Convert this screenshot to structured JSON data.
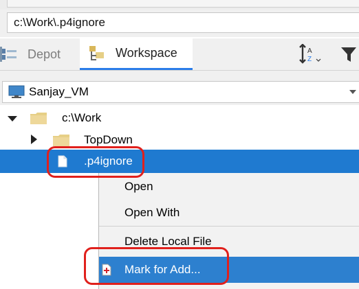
{
  "path": {
    "value": "c:\\Work\\.p4ignore"
  },
  "tabs": [
    {
      "label": "Depot",
      "icon": "depot-icon",
      "active": false
    },
    {
      "label": "Workspace",
      "icon": "workspace-icon",
      "active": true
    }
  ],
  "toolbar": {
    "sort_icon": "sort-az-icon",
    "filter_icon": "filter-icon"
  },
  "workspace_selector": {
    "value": "Sanjay_VM",
    "icon": "monitor-icon"
  },
  "tree": [
    {
      "label": "c:\\Work",
      "expanded": true,
      "type": "folder"
    },
    {
      "label": "TopDown",
      "expanded": false,
      "type": "folder"
    },
    {
      "label": ".p4ignore",
      "selected": true,
      "type": "file"
    }
  ],
  "context_menu": {
    "items": [
      {
        "label": "Open",
        "mnemonic": "O"
      },
      {
        "label": "Open With",
        "mnemonic": ""
      },
      {
        "label": "Delete Local File",
        "mnemonic": "D"
      },
      {
        "label": "Mark for Add...",
        "mnemonic": "A",
        "highlighted": true,
        "icon": "mark-for-add-icon"
      }
    ]
  },
  "colors": {
    "selection": "#1f7ad0",
    "menu_highlight": "#2d80cf",
    "active_tab_underline": "#2b7de9",
    "annotation": "#e0201c",
    "folder": "#e6cf86"
  }
}
